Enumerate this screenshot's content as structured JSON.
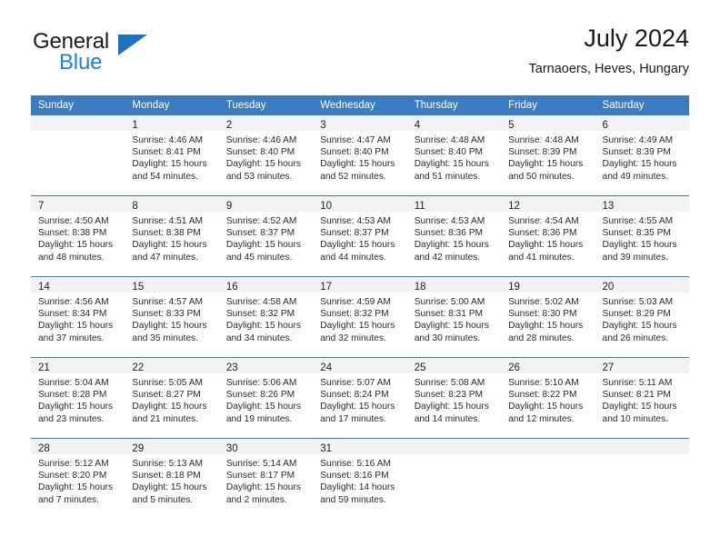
{
  "brand": {
    "name_top": "General",
    "name_bottom": "Blue"
  },
  "header": {
    "title": "July 2024",
    "subtitle": "Tarnaoers, Heves, Hungary"
  },
  "colors": {
    "header_blue": "#3b7cc0",
    "logo_blue": "#1f82d6",
    "daynum_band": "#f2f2f2"
  },
  "weekday_headers": [
    "Sunday",
    "Monday",
    "Tuesday",
    "Wednesday",
    "Thursday",
    "Friday",
    "Saturday"
  ],
  "weeks": [
    [
      {
        "day": "",
        "sunrise": "",
        "sunset": "",
        "daylight1": "",
        "daylight2": "",
        "empty": true
      },
      {
        "day": "1",
        "sunrise": "Sunrise: 4:46 AM",
        "sunset": "Sunset: 8:41 PM",
        "daylight1": "Daylight: 15 hours",
        "daylight2": "and 54 minutes."
      },
      {
        "day": "2",
        "sunrise": "Sunrise: 4:46 AM",
        "sunset": "Sunset: 8:40 PM",
        "daylight1": "Daylight: 15 hours",
        "daylight2": "and 53 minutes."
      },
      {
        "day": "3",
        "sunrise": "Sunrise: 4:47 AM",
        "sunset": "Sunset: 8:40 PM",
        "daylight1": "Daylight: 15 hours",
        "daylight2": "and 52 minutes."
      },
      {
        "day": "4",
        "sunrise": "Sunrise: 4:48 AM",
        "sunset": "Sunset: 8:40 PM",
        "daylight1": "Daylight: 15 hours",
        "daylight2": "and 51 minutes."
      },
      {
        "day": "5",
        "sunrise": "Sunrise: 4:48 AM",
        "sunset": "Sunset: 8:39 PM",
        "daylight1": "Daylight: 15 hours",
        "daylight2": "and 50 minutes."
      },
      {
        "day": "6",
        "sunrise": "Sunrise: 4:49 AM",
        "sunset": "Sunset: 8:39 PM",
        "daylight1": "Daylight: 15 hours",
        "daylight2": "and 49 minutes."
      }
    ],
    [
      {
        "day": "7",
        "sunrise": "Sunrise: 4:50 AM",
        "sunset": "Sunset: 8:38 PM",
        "daylight1": "Daylight: 15 hours",
        "daylight2": "and 48 minutes."
      },
      {
        "day": "8",
        "sunrise": "Sunrise: 4:51 AM",
        "sunset": "Sunset: 8:38 PM",
        "daylight1": "Daylight: 15 hours",
        "daylight2": "and 47 minutes."
      },
      {
        "day": "9",
        "sunrise": "Sunrise: 4:52 AM",
        "sunset": "Sunset: 8:37 PM",
        "daylight1": "Daylight: 15 hours",
        "daylight2": "and 45 minutes."
      },
      {
        "day": "10",
        "sunrise": "Sunrise: 4:53 AM",
        "sunset": "Sunset: 8:37 PM",
        "daylight1": "Daylight: 15 hours",
        "daylight2": "and 44 minutes."
      },
      {
        "day": "11",
        "sunrise": "Sunrise: 4:53 AM",
        "sunset": "Sunset: 8:36 PM",
        "daylight1": "Daylight: 15 hours",
        "daylight2": "and 42 minutes."
      },
      {
        "day": "12",
        "sunrise": "Sunrise: 4:54 AM",
        "sunset": "Sunset: 8:36 PM",
        "daylight1": "Daylight: 15 hours",
        "daylight2": "and 41 minutes."
      },
      {
        "day": "13",
        "sunrise": "Sunrise: 4:55 AM",
        "sunset": "Sunset: 8:35 PM",
        "daylight1": "Daylight: 15 hours",
        "daylight2": "and 39 minutes."
      }
    ],
    [
      {
        "day": "14",
        "sunrise": "Sunrise: 4:56 AM",
        "sunset": "Sunset: 8:34 PM",
        "daylight1": "Daylight: 15 hours",
        "daylight2": "and 37 minutes."
      },
      {
        "day": "15",
        "sunrise": "Sunrise: 4:57 AM",
        "sunset": "Sunset: 8:33 PM",
        "daylight1": "Daylight: 15 hours",
        "daylight2": "and 35 minutes."
      },
      {
        "day": "16",
        "sunrise": "Sunrise: 4:58 AM",
        "sunset": "Sunset: 8:32 PM",
        "daylight1": "Daylight: 15 hours",
        "daylight2": "and 34 minutes."
      },
      {
        "day": "17",
        "sunrise": "Sunrise: 4:59 AM",
        "sunset": "Sunset: 8:32 PM",
        "daylight1": "Daylight: 15 hours",
        "daylight2": "and 32 minutes."
      },
      {
        "day": "18",
        "sunrise": "Sunrise: 5:00 AM",
        "sunset": "Sunset: 8:31 PM",
        "daylight1": "Daylight: 15 hours",
        "daylight2": "and 30 minutes."
      },
      {
        "day": "19",
        "sunrise": "Sunrise: 5:02 AM",
        "sunset": "Sunset: 8:30 PM",
        "daylight1": "Daylight: 15 hours",
        "daylight2": "and 28 minutes."
      },
      {
        "day": "20",
        "sunrise": "Sunrise: 5:03 AM",
        "sunset": "Sunset: 8:29 PM",
        "daylight1": "Daylight: 15 hours",
        "daylight2": "and 26 minutes."
      }
    ],
    [
      {
        "day": "21",
        "sunrise": "Sunrise: 5:04 AM",
        "sunset": "Sunset: 8:28 PM",
        "daylight1": "Daylight: 15 hours",
        "daylight2": "and 23 minutes."
      },
      {
        "day": "22",
        "sunrise": "Sunrise: 5:05 AM",
        "sunset": "Sunset: 8:27 PM",
        "daylight1": "Daylight: 15 hours",
        "daylight2": "and 21 minutes."
      },
      {
        "day": "23",
        "sunrise": "Sunrise: 5:06 AM",
        "sunset": "Sunset: 8:26 PM",
        "daylight1": "Daylight: 15 hours",
        "daylight2": "and 19 minutes."
      },
      {
        "day": "24",
        "sunrise": "Sunrise: 5:07 AM",
        "sunset": "Sunset: 8:24 PM",
        "daylight1": "Daylight: 15 hours",
        "daylight2": "and 17 minutes."
      },
      {
        "day": "25",
        "sunrise": "Sunrise: 5:08 AM",
        "sunset": "Sunset: 8:23 PM",
        "daylight1": "Daylight: 15 hours",
        "daylight2": "and 14 minutes."
      },
      {
        "day": "26",
        "sunrise": "Sunrise: 5:10 AM",
        "sunset": "Sunset: 8:22 PM",
        "daylight1": "Daylight: 15 hours",
        "daylight2": "and 12 minutes."
      },
      {
        "day": "27",
        "sunrise": "Sunrise: 5:11 AM",
        "sunset": "Sunset: 8:21 PM",
        "daylight1": "Daylight: 15 hours",
        "daylight2": "and 10 minutes."
      }
    ],
    [
      {
        "day": "28",
        "sunrise": "Sunrise: 5:12 AM",
        "sunset": "Sunset: 8:20 PM",
        "daylight1": "Daylight: 15 hours",
        "daylight2": "and 7 minutes."
      },
      {
        "day": "29",
        "sunrise": "Sunrise: 5:13 AM",
        "sunset": "Sunset: 8:18 PM",
        "daylight1": "Daylight: 15 hours",
        "daylight2": "and 5 minutes."
      },
      {
        "day": "30",
        "sunrise": "Sunrise: 5:14 AM",
        "sunset": "Sunset: 8:17 PM",
        "daylight1": "Daylight: 15 hours",
        "daylight2": "and 2 minutes."
      },
      {
        "day": "31",
        "sunrise": "Sunrise: 5:16 AM",
        "sunset": "Sunset: 8:16 PM",
        "daylight1": "Daylight: 14 hours",
        "daylight2": "and 59 minutes."
      },
      {
        "day": "",
        "sunrise": "",
        "sunset": "",
        "daylight1": "",
        "daylight2": "",
        "empty": true
      },
      {
        "day": "",
        "sunrise": "",
        "sunset": "",
        "daylight1": "",
        "daylight2": "",
        "empty": true
      },
      {
        "day": "",
        "sunrise": "",
        "sunset": "",
        "daylight1": "",
        "daylight2": "",
        "empty": true
      }
    ]
  ]
}
